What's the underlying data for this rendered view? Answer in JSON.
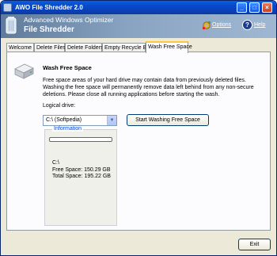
{
  "window": {
    "title": "AWO File Shredder 2.0"
  },
  "titlebar_buttons": {
    "minimize": "_",
    "maximize": "□",
    "close": "×"
  },
  "header": {
    "suite_name": "Advanced Windows Optimizer",
    "module_name": "File Shredder",
    "options_label": "Options",
    "help_label": "Help",
    "help_glyph": "?"
  },
  "tabs": [
    {
      "label": "Welcome"
    },
    {
      "label": "Delete Files"
    },
    {
      "label": "Delete Folders"
    },
    {
      "label": "Empty Recycle Bin"
    },
    {
      "label": "Wash Free Space",
      "active": true
    }
  ],
  "panel": {
    "title": "Wash Free Space",
    "description": "Free space areas of your hard drive may contain data from previously deleted files. Washing the free space will permanently remove data left behind from any non-secure deletions. Please close all running applications before starting the wash.",
    "drive_label": "Logical drive:",
    "drive_selected": "C:\\ (Softpedia)",
    "wash_button": "Start Washing Free Space",
    "info": {
      "legend": "Information",
      "progress": 0,
      "drive": "C:\\",
      "free_space": "Free Space: 150.29 GB",
      "total_space": "Total Space: 195.22 GB"
    }
  },
  "footer": {
    "exit_button": "Exit"
  },
  "icons": [
    "app-icon",
    "recycle-bin-logo-icon",
    "gear-icon",
    "help-icon",
    "hard-drive-icon",
    "chevron-down-icon"
  ]
}
